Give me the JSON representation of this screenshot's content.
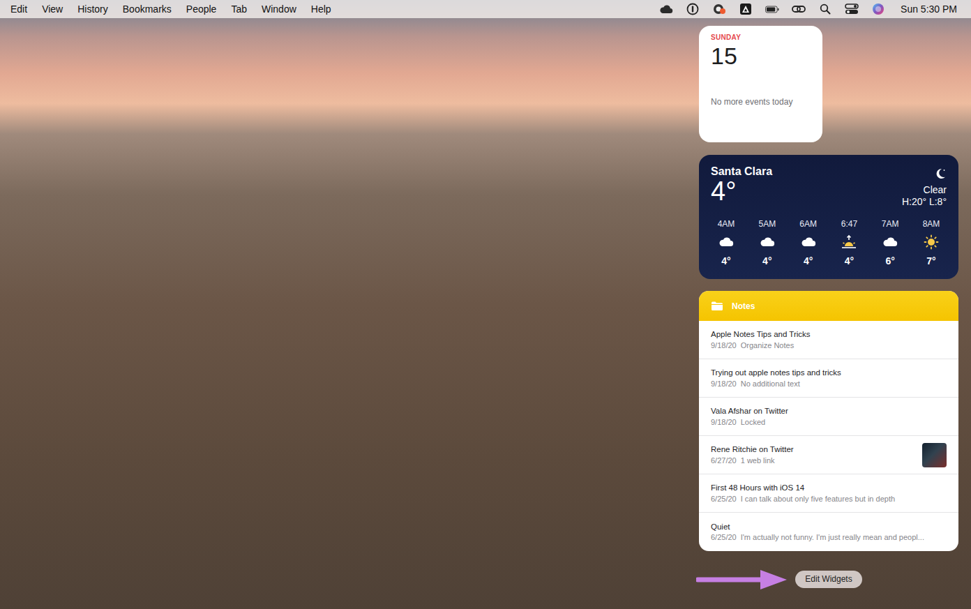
{
  "menu_bar": {
    "menus": [
      "Edit",
      "View",
      "History",
      "Bookmarks",
      "People",
      "Tab",
      "Window",
      "Help"
    ],
    "clock": "Sun 5:30 PM"
  },
  "calendar_widget": {
    "weekday": "SUNDAY",
    "date": "15",
    "message": "No more events today"
  },
  "weather_widget": {
    "location": "Santa Clara",
    "temperature": "4°",
    "condition": "Clear",
    "high_low": "H:20° L:8°",
    "hours": [
      {
        "time": "4AM",
        "temp": "4°",
        "kind": "cloud"
      },
      {
        "time": "5AM",
        "temp": "4°",
        "kind": "cloud"
      },
      {
        "time": "6AM",
        "temp": "4°",
        "kind": "cloud"
      },
      {
        "time": "6:47",
        "temp": "4°",
        "kind": "sunrise"
      },
      {
        "time": "7AM",
        "temp": "6°",
        "kind": "cloud"
      },
      {
        "time": "8AM",
        "temp": "7°",
        "kind": "sun"
      }
    ]
  },
  "notes_widget": {
    "title": "Notes",
    "notes": [
      {
        "title": "Apple Notes Tips and Tricks",
        "date": "9/18/20",
        "detail": "Organize Notes",
        "kind": "text"
      },
      {
        "title": "Trying out apple notes tips and tricks",
        "date": "9/18/20",
        "detail": "No additional text",
        "kind": "text"
      },
      {
        "title": "Vala Afshar on Twitter",
        "date": "9/18/20",
        "detail": "Locked",
        "kind": "text"
      },
      {
        "title": "Rene Ritchie on Twitter",
        "date": "6/27/20",
        "detail": "1 web link",
        "kind": "thumbnail"
      },
      {
        "title": "First 48 Hours with iOS 14",
        "date": "6/25/20",
        "detail": "I can talk about only five features but in depth",
        "kind": "text"
      },
      {
        "title": "Quiet",
        "date": "6/25/20",
        "detail": "I'm actually not funny. I'm just really mean and peopl...",
        "kind": "text"
      }
    ]
  },
  "edit_button": {
    "label": "Edit Widgets"
  }
}
